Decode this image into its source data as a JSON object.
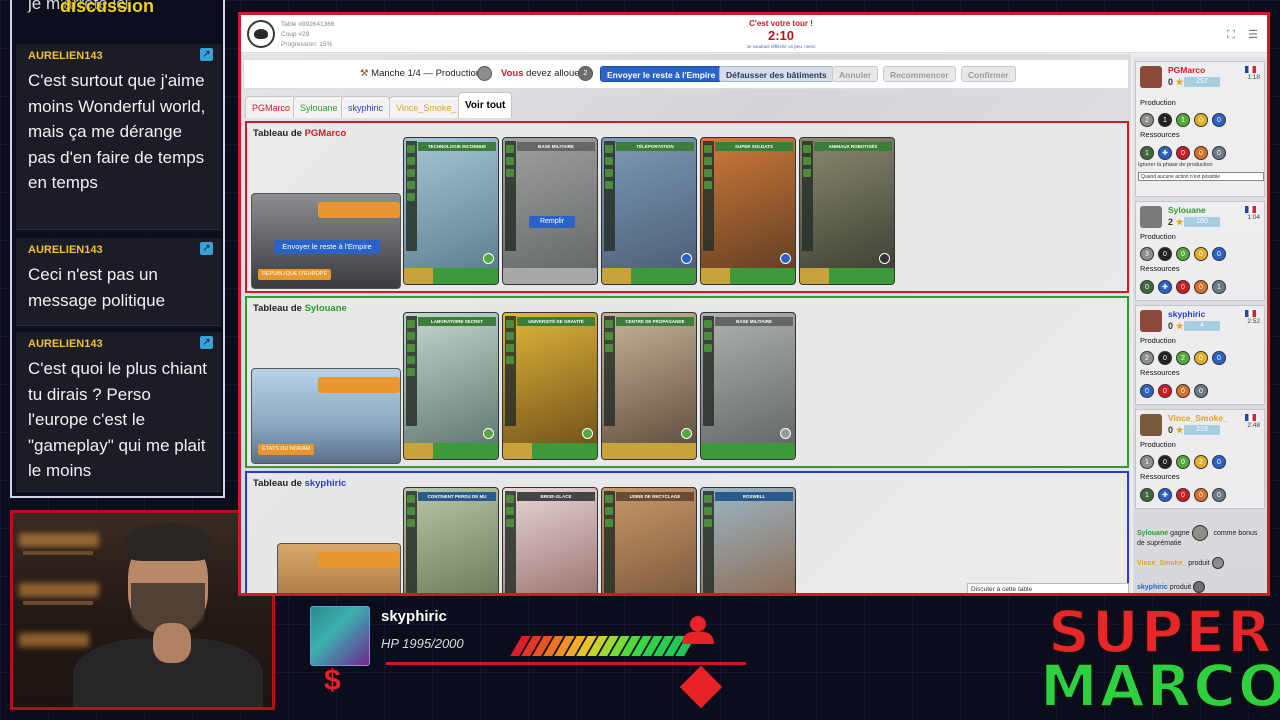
{
  "chat": {
    "title": "discussion",
    "cut_text": "je m'arrête ici",
    "messages": [
      {
        "author": "AURELIEN143",
        "text": "C'est surtout que j'aime moins Wonderful world, mais ça me dérange pas d'en faire de temps en temps"
      },
      {
        "author": "AURELIEN143",
        "text": "Ceci n'est pas un message politique"
      },
      {
        "author": "AURELIEN143",
        "text": "C'est quoi le plus chiant tu dirais ? Perso l'europe c'est le \"gameplay\" qui me plait le moins"
      }
    ]
  },
  "game": {
    "table_info": [
      "Table #892641366",
      "Coup #29",
      "Progression: 15%"
    ],
    "turn_message": "C'est votre tour !",
    "timer": "2:10",
    "turn_sub": "Je voudrais réfléchir un peu, merci",
    "actionbar": {
      "round": "Manche 1/4 — Production",
      "you": "Vous",
      "must": "devez allouer",
      "token_value": "2",
      "btn_send": "Envoyer le reste à l'Empire",
      "btn_demolish": "Défausser des bâtiments",
      "btn_cancel": "Annuler",
      "btn_restart": "Recommencer",
      "btn_confirm": "Confirmer"
    },
    "tabs": [
      {
        "label": "PGMarco",
        "color": "#d11a25"
      },
      {
        "label": "Sylouane",
        "color": "#2f9a2f"
      },
      {
        "label": "skyphiric",
        "color": "#2a3cd0"
      },
      {
        "label": "Vince_Smoke_",
        "color": "#e0a020"
      },
      {
        "label": "Voir tout",
        "color": "#000000"
      }
    ],
    "tableaus": [
      {
        "prefix": "Tableau de",
        "player": "PGMarco",
        "player_color": "#d11a25",
        "empire_name": "RÉPUBLIQUE D'EUROPE",
        "empire_button": "Envoyer le reste à l'Empire",
        "cards": [
          {
            "title": "TECHNOLOGIE INCONNUE"
          },
          {
            "title": "BASE MILITAIRE",
            "button": "Remplir"
          },
          {
            "title": "TÉLÉPORTATION"
          },
          {
            "title": "SUPER SOLDATS"
          },
          {
            "title": "ANIMAUX ROBOTISÉS"
          }
        ]
      },
      {
        "prefix": "Tableau de",
        "player": "Sylouane",
        "player_color": "#2f9a2f",
        "empire_name": "ÉTATS DU NORAM",
        "cards": [
          {
            "title": "LABORATOIRE SECRET"
          },
          {
            "title": "UNIVERSITÉ DE GRAVITÉ"
          },
          {
            "title": "CENTRE DE PROPAGANDE"
          },
          {
            "title": "BASE MILITAIRE"
          }
        ]
      },
      {
        "prefix": "Tableau de",
        "player": "skyphiric",
        "player_color": "#2a3cd0",
        "cards": [
          {
            "title": "CONTINENT PERDU DE MU"
          },
          {
            "title": "BRISE-GLACE"
          },
          {
            "title": "USINE DE RECYCLAGE"
          },
          {
            "title": "ROSWELL"
          }
        ]
      }
    ],
    "players": [
      {
        "name": "PGMarco",
        "color": "#d11a25",
        "score": "0",
        "badge": "257",
        "time": "1:18",
        "production_label": "Production",
        "production": [
          "2",
          "1",
          "1",
          "0",
          "0"
        ],
        "resources_label": "Ressources",
        "resources": [
          "1",
          "0",
          "0",
          "0",
          "0"
        ],
        "skip_label": "Ignorer la phase de production",
        "skip_value": "Quand aucune action n'est possible"
      },
      {
        "name": "Sylouane",
        "color": "#2f9a2f",
        "score": "2",
        "badge": "180",
        "time": "1:04",
        "production_label": "Production",
        "production": [
          "3",
          "0",
          "0",
          "0",
          "0"
        ],
        "resources_label": "Ressources",
        "resources": [
          "0",
          "0",
          "0",
          "0",
          "1"
        ]
      },
      {
        "name": "skyphiric",
        "color": "#2a3cd0",
        "score": "0",
        "badge": "4",
        "time": "2:52",
        "production_label": "Production",
        "production": [
          "2",
          "0",
          "2",
          "0",
          "0"
        ],
        "resources_label": "Ressources",
        "resources": [
          "0",
          "0",
          "0",
          "0",
          "0"
        ]
      },
      {
        "name": "Vince_Smoke_",
        "color": "#e0a020",
        "score": "0",
        "badge": "219",
        "time": "2:48",
        "production_label": "Production",
        "production": [
          "1",
          "0",
          "0",
          "2",
          "0"
        ],
        "resources_label": "Ressources",
        "resources": [
          "1",
          "0",
          "0",
          "0",
          "0"
        ]
      }
    ],
    "log": [
      {
        "player": "Sylouane",
        "text": "gagne",
        "suffix": "comme bonus"
      },
      {
        "text": "de suprématie"
      },
      {
        "player": "Vince_Smoke_",
        "text": "produit"
      },
      {
        "player": "skyphiric",
        "text": "produit"
      }
    ],
    "discuss": "Discuter à cette table"
  },
  "overlay": {
    "sub_name": "skyphiric",
    "hp": "HP 1995/2000",
    "hp_fraction": 0.9975,
    "dollar": "$"
  },
  "logo": {
    "line1": "SUPER",
    "line2": "MARCO"
  },
  "colors": {
    "frame": "#d11a25",
    "accent_blue": "#2a63c8",
    "chat_author": "#f2c230"
  }
}
